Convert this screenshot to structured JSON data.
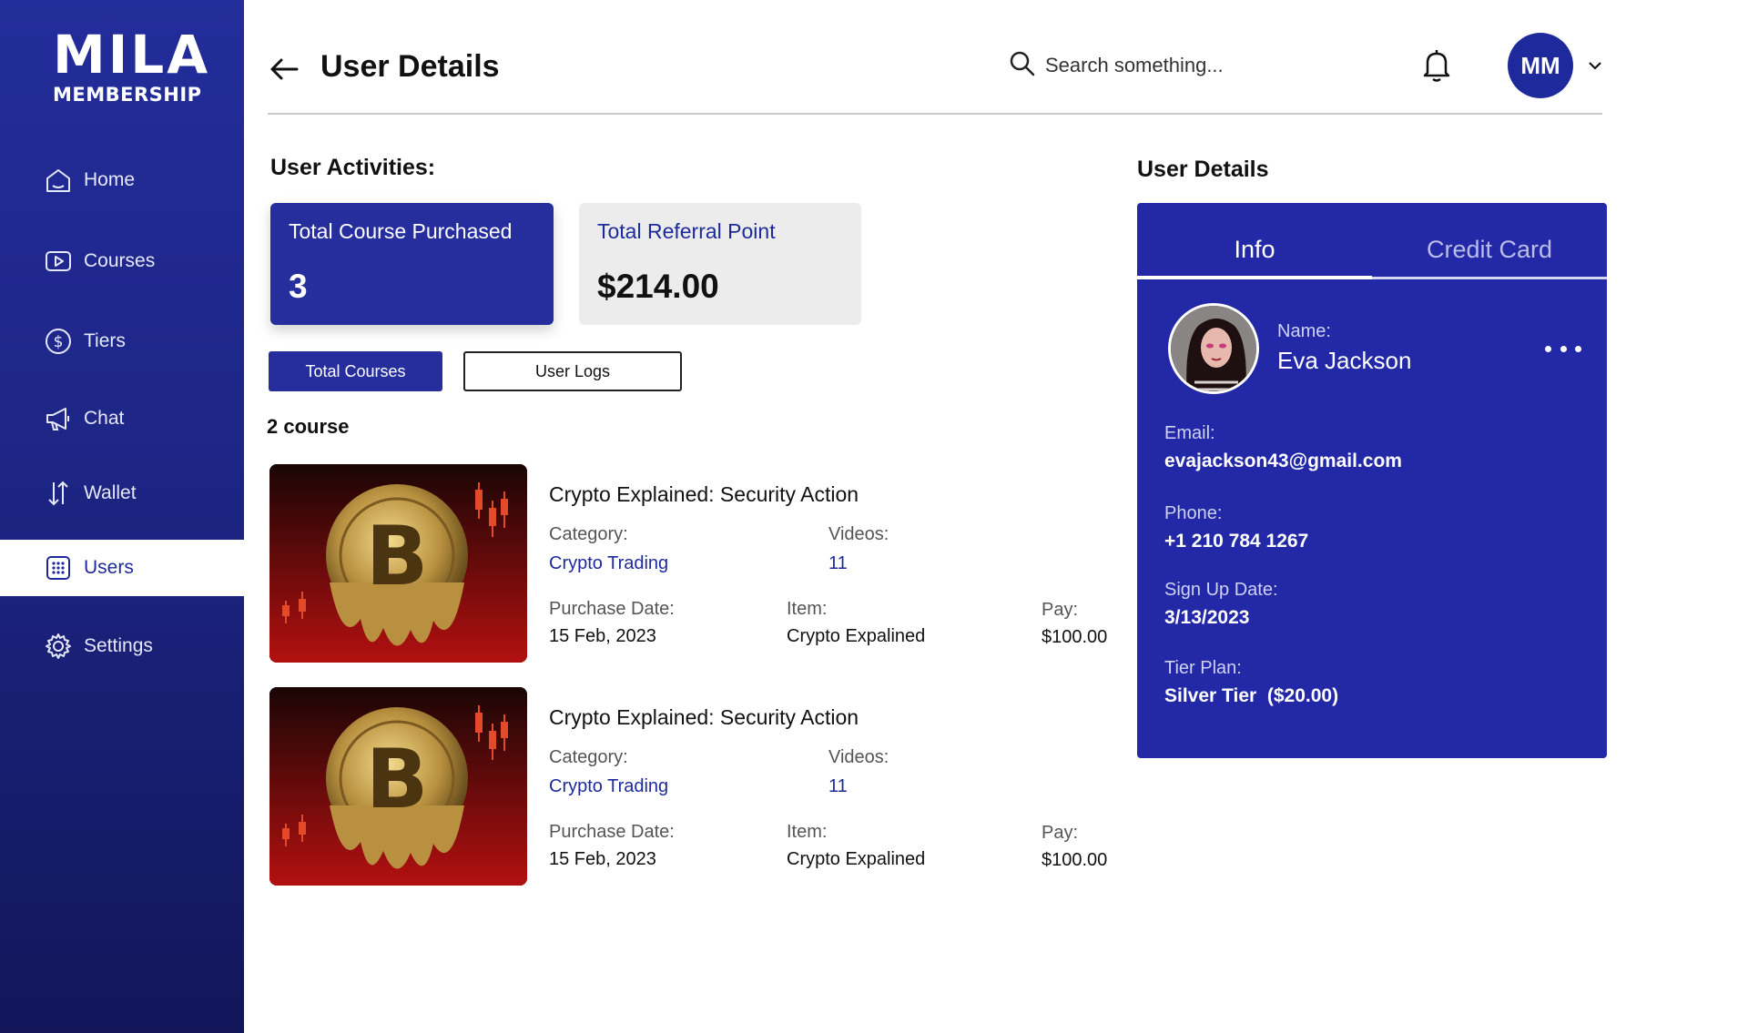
{
  "brand": {
    "logo_top": "MILA",
    "logo_bottom": "MEMBERSHIP"
  },
  "sidebar": {
    "items": [
      {
        "label": "Home",
        "icon": "home-icon",
        "active": false
      },
      {
        "label": "Courses",
        "icon": "play-icon",
        "active": false
      },
      {
        "label": "Tiers",
        "icon": "dollar-icon",
        "active": false
      },
      {
        "label": "Chat",
        "icon": "megaphone-icon",
        "active": false
      },
      {
        "label": "Wallet",
        "icon": "arrows-icon",
        "active": false
      },
      {
        "label": "Users",
        "icon": "users-grid-icon",
        "active": true
      },
      {
        "label": "Settings",
        "icon": "gear-icon",
        "active": false
      }
    ]
  },
  "header": {
    "title": "User Details",
    "search_placeholder": "Search something...",
    "avatar_initials": "MM"
  },
  "activities": {
    "heading": "User Activities:",
    "stats": [
      {
        "label": "Total Course Purchased",
        "value": "3"
      },
      {
        "label": "Total Referral Point",
        "value": "$214.00"
      }
    ],
    "tabs": {
      "active": "Total Courses",
      "other": "User Logs"
    },
    "course_count": "2 course",
    "labels": {
      "category": "Category:",
      "videos": "Videos:",
      "purchase_date": "Purchase Date:",
      "item": "Item:",
      "pay": "Pay:"
    },
    "courses": [
      {
        "title": "Crypto Explained: Security Action",
        "category": "Crypto Trading",
        "videos": "11",
        "purchase_date": "15 Feb, 2023",
        "item": "Crypto Expalined",
        "pay": "$100.00"
      },
      {
        "title": "Crypto Explained: Security Action",
        "category": "Crypto Trading",
        "videos": "11",
        "purchase_date": "15 Feb, 2023",
        "item": "Crypto Expalined",
        "pay": "$100.00"
      }
    ]
  },
  "details": {
    "heading": "User Details",
    "tabs": [
      "Info",
      "Credit Card"
    ],
    "name_label": "Name:",
    "name": "Eva Jackson",
    "email_label": "Email:",
    "email": "evajackson43@gmail.com",
    "phone_label": "Phone:",
    "phone": "+1 210 784 1267",
    "signup_label": "Sign Up Date:",
    "signup": "3/13/2023",
    "tier_label": "Tier Plan:",
    "tier": "Silver Tier  ($20.00)"
  },
  "colors": {
    "primary": "#252e9c",
    "sidebar_dark": "#121659",
    "card_bg": "#2228a6",
    "stat_grey": "#ececec"
  }
}
